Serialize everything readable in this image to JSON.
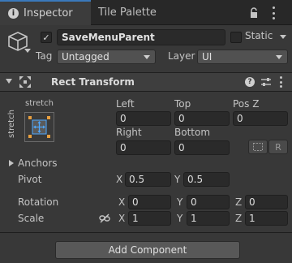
{
  "tabs": [
    {
      "label": "Inspector",
      "icon": "info-icon",
      "active": true
    },
    {
      "label": "Tile Palette",
      "active": false
    }
  ],
  "header": {
    "active": true,
    "name": "SaveMenuParent",
    "static_label": "Static",
    "static_checked": false,
    "tag_label": "Tag",
    "tag_value": "Untagged",
    "layer_label": "Layer",
    "layer_value": "UI"
  },
  "rect_transform": {
    "title": "Rect Transform",
    "preset_h_label": "stretch",
    "preset_v_label": "stretch",
    "left_label": "Left",
    "left_value": "0",
    "top_label": "Top",
    "top_value": "0",
    "posz_label": "Pos Z",
    "posz_value": "0",
    "right_label": "Right",
    "right_value": "0",
    "bottom_label": "Bottom",
    "bottom_value": "0",
    "blueprint_button": "",
    "raw_button": "R",
    "anchors_label": "Anchors",
    "pivot_label": "Pivot",
    "pivot": {
      "x_label": "X",
      "x": "0.5",
      "y_label": "Y",
      "y": "0.5"
    },
    "rotation_label": "Rotation",
    "rotation": {
      "x_label": "X",
      "x": "0",
      "y_label": "Y",
      "y": "0",
      "z_label": "Z",
      "z": "0"
    },
    "scale_label": "Scale",
    "scale": {
      "x_label": "X",
      "x": "1",
      "y_label": "Y",
      "y": "1",
      "z_label": "Z",
      "z": "1"
    }
  },
  "add_component_label": "Add Component",
  "colors": {
    "background": "#383838",
    "tab_bar": "#282828",
    "accent": "#3a79bb",
    "field": "#2a2a2a",
    "anchor_blue": "#4fa8ff",
    "anchor_orange": "#e8a040"
  }
}
